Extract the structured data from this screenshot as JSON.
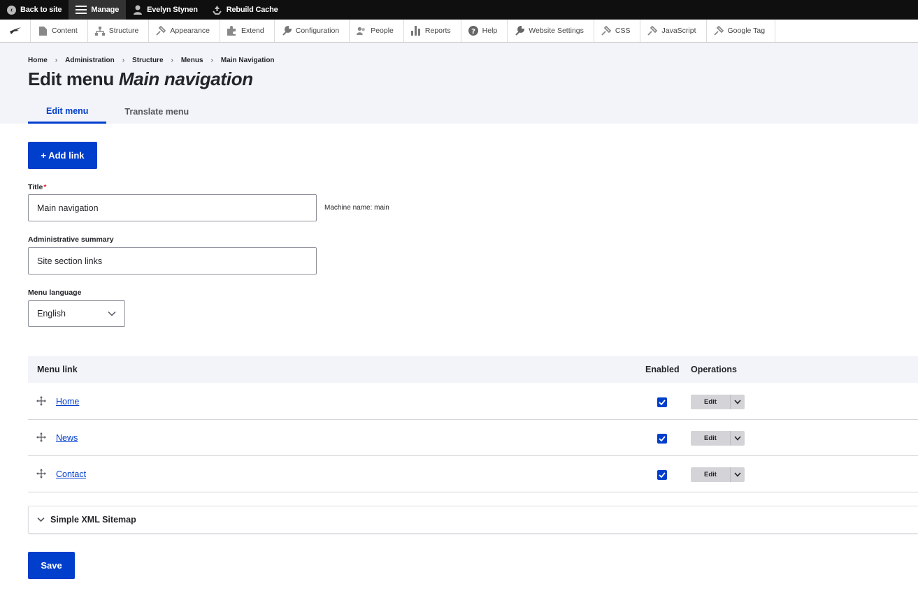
{
  "topbar": {
    "back": "Back to site",
    "manage": "Manage",
    "user": "Evelyn Stynen",
    "rebuild": "Rebuild Cache"
  },
  "tray": {
    "items": [
      {
        "label": "Content",
        "icon": "content-icon"
      },
      {
        "label": "Structure",
        "icon": "structure-icon"
      },
      {
        "label": "Appearance",
        "icon": "appearance-icon"
      },
      {
        "label": "Extend",
        "icon": "extend-icon"
      },
      {
        "label": "Configuration",
        "icon": "wrench-icon"
      },
      {
        "label": "People",
        "icon": "people-icon"
      },
      {
        "label": "Reports",
        "icon": "reports-icon"
      },
      {
        "label": "Help",
        "icon": "help-icon"
      },
      {
        "label": "Website Settings",
        "icon": "wrench-icon"
      },
      {
        "label": "CSS",
        "icon": "brush-icon"
      },
      {
        "label": "JavaScript",
        "icon": "brush-icon"
      },
      {
        "label": "Google Tag",
        "icon": "brush-icon"
      }
    ]
  },
  "breadcrumb": [
    "Home",
    "Administration",
    "Structure",
    "Menus",
    "Main Navigation"
  ],
  "title": {
    "prefix": "Edit menu",
    "name": "Main navigation"
  },
  "tabs": [
    "Edit menu",
    "Translate menu"
  ],
  "add_link": "+ Add link",
  "form": {
    "title_label": "Title",
    "title_required": "*",
    "title_value": "Main navigation",
    "machine_name": "Machine name: main",
    "summary_label": "Administrative summary",
    "summary_value": "Site section links",
    "language_label": "Menu language",
    "language_value": "English"
  },
  "table": {
    "headers": {
      "link": "Menu link",
      "enabled": "Enabled",
      "operations": "Operations"
    },
    "rows": [
      {
        "link": "Home",
        "enabled": true,
        "edit": "Edit"
      },
      {
        "link": "News",
        "enabled": true,
        "edit": "Edit"
      },
      {
        "link": "Contact",
        "enabled": true,
        "edit": "Edit"
      }
    ]
  },
  "details": {
    "label": "Simple XML Sitemap"
  },
  "save": "Save",
  "colors": {
    "accent": "#003ecc",
    "topbar": "#0f0f0f",
    "header_bg": "#f3f4f9"
  }
}
